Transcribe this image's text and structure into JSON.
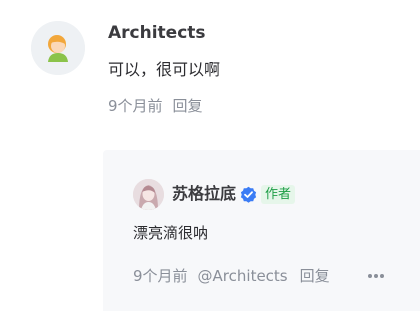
{
  "comment": {
    "author": "Architects",
    "content": "可以，很可以啊",
    "time": "9个月前",
    "reply_label": "回复",
    "avatar_icon": "user-avatar-icon"
  },
  "reply": {
    "author": "苏格拉底",
    "badge": "作者",
    "verified_icon": "verified-check-icon",
    "content": "漂亮滴很呐",
    "time": "9个月前",
    "mention": "@Architects",
    "reply_label": "回复",
    "more_icon": "more-dots-icon"
  },
  "colors": {
    "verified": "#3b7cf5",
    "badge_text": "#1e9e47",
    "badge_bg": "#e6f6ea",
    "reply_bg": "#f7f8fa",
    "meta_text": "#8a8f99"
  }
}
